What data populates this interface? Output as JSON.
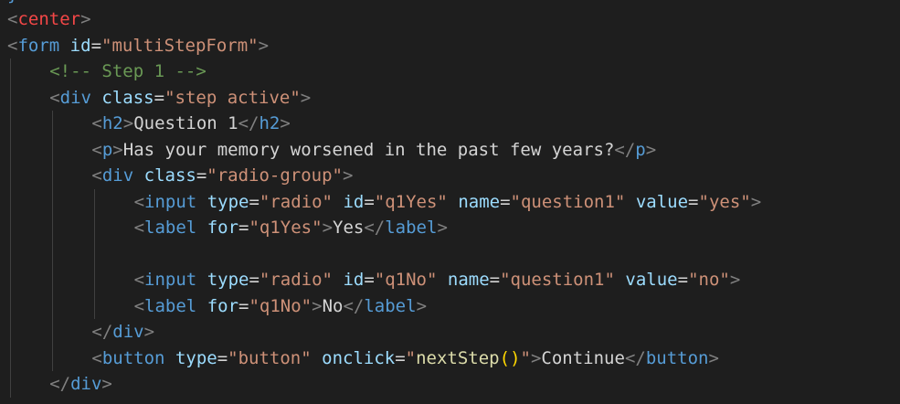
{
  "editor": {
    "top_fragment": "}",
    "colors": {
      "background": "#1e1e1e",
      "punctuation": "#808080",
      "tag": "#569cd6",
      "center_tag": "#f44747",
      "attribute": "#9cdcfe",
      "string": "#ce9178",
      "text": "#d4d4d4",
      "comment": "#6a9955",
      "function": "#dcdcaa",
      "paren": "#ffd700",
      "indent_guide": "#404040"
    },
    "lines": [
      {
        "indent": 0,
        "tokens": [
          {
            "k": "punct",
            "t": "<"
          },
          {
            "k": "tag-center",
            "t": "center"
          },
          {
            "k": "punct",
            "t": ">"
          }
        ]
      },
      {
        "indent": 0,
        "tokens": [
          {
            "k": "punct",
            "t": "<"
          },
          {
            "k": "tag",
            "t": "form"
          },
          {
            "k": "text",
            "t": " "
          },
          {
            "k": "attr",
            "t": "id"
          },
          {
            "k": "eq",
            "t": "="
          },
          {
            "k": "str",
            "t": "\"multiStepForm\""
          },
          {
            "k": "punct",
            "t": ">"
          }
        ]
      },
      {
        "indent": 1,
        "tokens": [
          {
            "k": "comment",
            "t": "<!-- Step 1 -->"
          }
        ]
      },
      {
        "indent": 1,
        "tokens": [
          {
            "k": "punct",
            "t": "<"
          },
          {
            "k": "tag",
            "t": "div"
          },
          {
            "k": "text",
            "t": " "
          },
          {
            "k": "attr",
            "t": "class"
          },
          {
            "k": "eq",
            "t": "="
          },
          {
            "k": "str",
            "t": "\"step active\""
          },
          {
            "k": "punct",
            "t": ">"
          }
        ]
      },
      {
        "indent": 2,
        "tokens": [
          {
            "k": "punct",
            "t": "<"
          },
          {
            "k": "tag",
            "t": "h2"
          },
          {
            "k": "punct",
            "t": ">"
          },
          {
            "k": "text",
            "t": "Question 1"
          },
          {
            "k": "punct",
            "t": "</"
          },
          {
            "k": "tag",
            "t": "h2"
          },
          {
            "k": "punct",
            "t": ">"
          }
        ]
      },
      {
        "indent": 2,
        "tokens": [
          {
            "k": "punct",
            "t": "<"
          },
          {
            "k": "tag",
            "t": "p"
          },
          {
            "k": "punct",
            "t": ">"
          },
          {
            "k": "text",
            "t": "Has your memory worsened in the past few years?"
          },
          {
            "k": "punct",
            "t": "</"
          },
          {
            "k": "tag",
            "t": "p"
          },
          {
            "k": "punct",
            "t": ">"
          }
        ]
      },
      {
        "indent": 2,
        "tokens": [
          {
            "k": "punct",
            "t": "<"
          },
          {
            "k": "tag",
            "t": "div"
          },
          {
            "k": "text",
            "t": " "
          },
          {
            "k": "attr",
            "t": "class"
          },
          {
            "k": "eq",
            "t": "="
          },
          {
            "k": "str",
            "t": "\"radio-group\""
          },
          {
            "k": "punct",
            "t": ">"
          }
        ]
      },
      {
        "indent": 3,
        "tokens": [
          {
            "k": "punct",
            "t": "<"
          },
          {
            "k": "tag",
            "t": "input"
          },
          {
            "k": "text",
            "t": " "
          },
          {
            "k": "attr",
            "t": "type"
          },
          {
            "k": "eq",
            "t": "="
          },
          {
            "k": "str",
            "t": "\"radio\""
          },
          {
            "k": "text",
            "t": " "
          },
          {
            "k": "attr",
            "t": "id"
          },
          {
            "k": "eq",
            "t": "="
          },
          {
            "k": "str",
            "t": "\"q1Yes\""
          },
          {
            "k": "text",
            "t": " "
          },
          {
            "k": "attr",
            "t": "name"
          },
          {
            "k": "eq",
            "t": "="
          },
          {
            "k": "str",
            "t": "\"question1\""
          },
          {
            "k": "text",
            "t": " "
          },
          {
            "k": "attr",
            "t": "value"
          },
          {
            "k": "eq",
            "t": "="
          },
          {
            "k": "str",
            "t": "\"yes\""
          },
          {
            "k": "punct",
            "t": ">"
          }
        ]
      },
      {
        "indent": 3,
        "tokens": [
          {
            "k": "punct",
            "t": "<"
          },
          {
            "k": "tag",
            "t": "label"
          },
          {
            "k": "text",
            "t": " "
          },
          {
            "k": "attr",
            "t": "for"
          },
          {
            "k": "eq",
            "t": "="
          },
          {
            "k": "str",
            "t": "\"q1Yes\""
          },
          {
            "k": "punct",
            "t": ">"
          },
          {
            "k": "text",
            "t": "Yes"
          },
          {
            "k": "punct",
            "t": "</"
          },
          {
            "k": "tag",
            "t": "label"
          },
          {
            "k": "punct",
            "t": ">"
          }
        ]
      },
      {
        "indent": 3,
        "tokens": []
      },
      {
        "indent": 3,
        "tokens": [
          {
            "k": "punct",
            "t": "<"
          },
          {
            "k": "tag",
            "t": "input"
          },
          {
            "k": "text",
            "t": " "
          },
          {
            "k": "attr",
            "t": "type"
          },
          {
            "k": "eq",
            "t": "="
          },
          {
            "k": "str",
            "t": "\"radio\""
          },
          {
            "k": "text",
            "t": " "
          },
          {
            "k": "attr",
            "t": "id"
          },
          {
            "k": "eq",
            "t": "="
          },
          {
            "k": "str",
            "t": "\"q1No\""
          },
          {
            "k": "text",
            "t": " "
          },
          {
            "k": "attr",
            "t": "name"
          },
          {
            "k": "eq",
            "t": "="
          },
          {
            "k": "str",
            "t": "\"question1\""
          },
          {
            "k": "text",
            "t": " "
          },
          {
            "k": "attr",
            "t": "value"
          },
          {
            "k": "eq",
            "t": "="
          },
          {
            "k": "str",
            "t": "\"no\""
          },
          {
            "k": "punct",
            "t": ">"
          }
        ]
      },
      {
        "indent": 3,
        "tokens": [
          {
            "k": "punct",
            "t": "<"
          },
          {
            "k": "tag",
            "t": "label"
          },
          {
            "k": "text",
            "t": " "
          },
          {
            "k": "attr",
            "t": "for"
          },
          {
            "k": "eq",
            "t": "="
          },
          {
            "k": "str",
            "t": "\"q1No\""
          },
          {
            "k": "punct",
            "t": ">"
          },
          {
            "k": "text",
            "t": "No"
          },
          {
            "k": "punct",
            "t": "</"
          },
          {
            "k": "tag",
            "t": "label"
          },
          {
            "k": "punct",
            "t": ">"
          }
        ]
      },
      {
        "indent": 2,
        "tokens": [
          {
            "k": "punct",
            "t": "</"
          },
          {
            "k": "tag",
            "t": "div"
          },
          {
            "k": "punct",
            "t": ">"
          }
        ]
      },
      {
        "indent": 2,
        "tokens": [
          {
            "k": "punct",
            "t": "<"
          },
          {
            "k": "tag",
            "t": "button"
          },
          {
            "k": "text",
            "t": " "
          },
          {
            "k": "attr",
            "t": "type"
          },
          {
            "k": "eq",
            "t": "="
          },
          {
            "k": "str",
            "t": "\"button\""
          },
          {
            "k": "text",
            "t": " "
          },
          {
            "k": "attr",
            "t": "onclick"
          },
          {
            "k": "eq",
            "t": "="
          },
          {
            "k": "str",
            "t": "\""
          },
          {
            "k": "func",
            "t": "nextStep"
          },
          {
            "k": "paren",
            "t": "()"
          },
          {
            "k": "str",
            "t": "\""
          },
          {
            "k": "punct",
            "t": ">"
          },
          {
            "k": "text",
            "t": "Continue"
          },
          {
            "k": "punct",
            "t": "</"
          },
          {
            "k": "tag",
            "t": "button"
          },
          {
            "k": "punct",
            "t": ">"
          }
        ]
      },
      {
        "indent": 1,
        "tokens": [
          {
            "k": "punct",
            "t": "</"
          },
          {
            "k": "tag",
            "t": "div"
          },
          {
            "k": "punct",
            "t": ">"
          }
        ]
      }
    ]
  }
}
